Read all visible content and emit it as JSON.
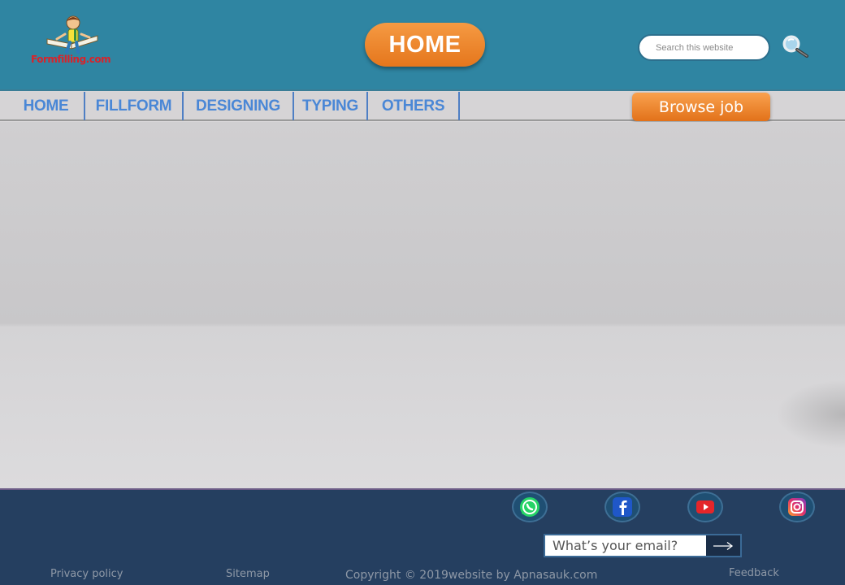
{
  "header": {
    "logo_text": "Formfilling.com",
    "page_title": "HOME",
    "search_placeholder": "Search this website"
  },
  "nav": {
    "items": [
      {
        "label": "HOME"
      },
      {
        "label": "FILLFORM"
      },
      {
        "label": "DESIGNING"
      },
      {
        "label": "TYPING"
      },
      {
        "label": "OTHERS"
      }
    ],
    "browse_button": "Browse job"
  },
  "footer": {
    "social": [
      {
        "icon": "whatsapp-icon"
      },
      {
        "icon": "facebook-icon"
      },
      {
        "icon": "youtube-icon"
      },
      {
        "icon": "instagram-icon"
      }
    ],
    "email_placeholder": "What’s your email?",
    "links": {
      "privacy": "Privacy policy",
      "sitemap": "Sitemap",
      "copyright": "Copyright © 2019website by Apnasauk.com",
      "feedback": "Feedback"
    }
  },
  "colors": {
    "header_bg": "#2f85a2",
    "accent_orange": "#e5761c",
    "nav_text": "#4a87d6",
    "footer_bg": "#253f60"
  }
}
